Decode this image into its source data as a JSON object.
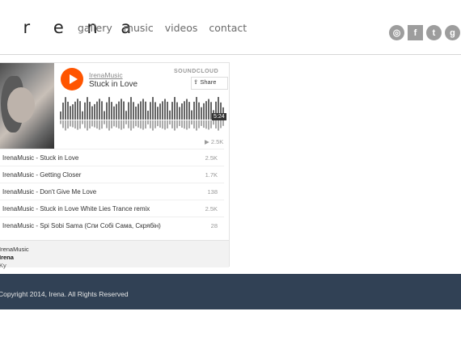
{
  "site": {
    "logo": "i r e n a"
  },
  "nav": [
    {
      "label": "gallery"
    },
    {
      "label": "music"
    },
    {
      "label": "videos"
    },
    {
      "label": "contact"
    }
  ],
  "social": [
    {
      "icon": "instagram-icon",
      "glyph": "◎"
    },
    {
      "icon": "facebook-icon",
      "glyph": "f"
    },
    {
      "icon": "twitter-icon",
      "glyph": "t"
    },
    {
      "icon": "google-plus-icon",
      "glyph": "g"
    }
  ],
  "player": {
    "artist": "IrenaMusic",
    "track": "Stuck in Love",
    "brand": "SOUNDCLOUD",
    "share_label": "Share",
    "duration": "5:24",
    "plays": "2.5K",
    "tracks": [
      {
        "title": "IrenaMusic - Stuck in Love",
        "count": "2.5K"
      },
      {
        "title": "IrenaMusic - Getting Closer",
        "count": "1.7K"
      },
      {
        "title": "IrenaMusic - Don't Give Me Love",
        "count": "138"
      },
      {
        "title": "IrenaMusic - Stuck in Love White Lies Trance remix",
        "count": "2.5K"
      },
      {
        "title": "IrenaMusic - Spi Sobi Sama  (Спи Собі Сама, Скрябін)",
        "count": "28"
      }
    ],
    "owner_user": "IrenaMusic",
    "owner_name": "Irena",
    "owner_extra": "Ky"
  },
  "footer": {
    "text": "Copyright 2014, Irena. All Rights Reserved"
  }
}
